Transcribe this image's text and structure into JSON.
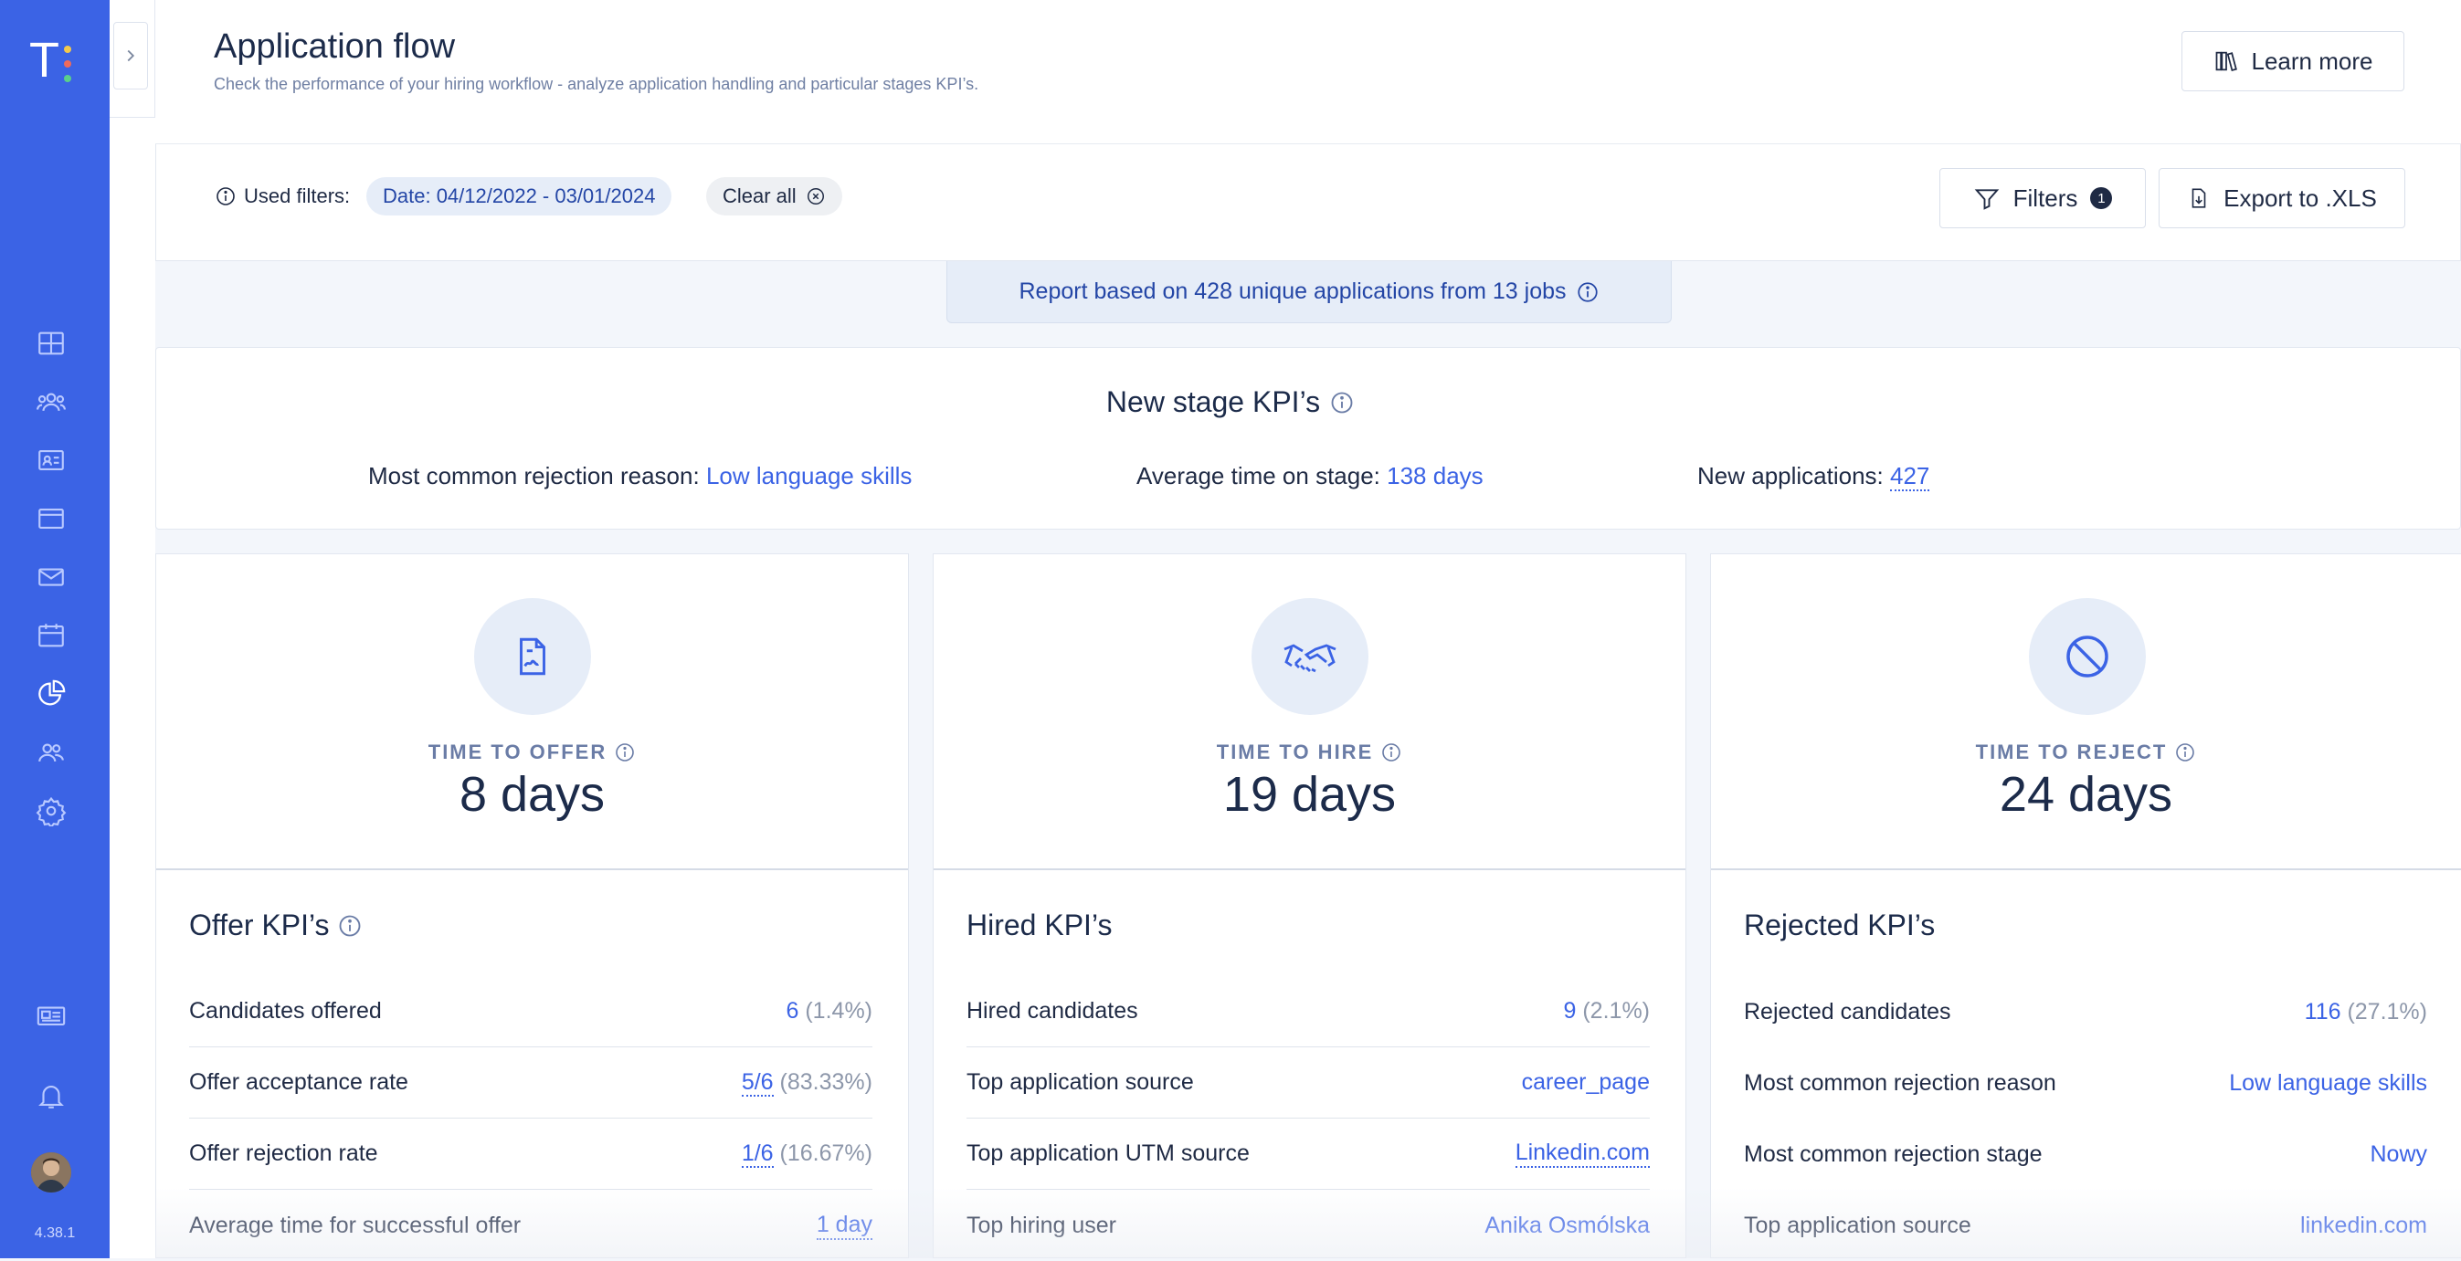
{
  "app": {
    "logo_letter": "T",
    "version": "4.38.1",
    "accent": "#3b63e5",
    "collapse_icon": "chevron-right-icon"
  },
  "sidebar_icons": [
    "dashboard-icon",
    "candidates-icon",
    "contact-card-icon",
    "jobs-window-icon",
    "mail-icon",
    "calendar-icon",
    "reports-pie-icon",
    "team-icon",
    "settings-gear-icon",
    "news-icon",
    "bell-icon"
  ],
  "header": {
    "title": "Application flow",
    "subtitle": "Check the performance of your hiring workflow - analyze application handling and particular stages KPI’s.",
    "learn_more": "Learn more"
  },
  "filters": {
    "used_label": "Used filters:",
    "date_chip": "Date: 04/12/2022 - 03/01/2024",
    "clear_all": "Clear all",
    "filters_button": "Filters",
    "filters_count": "1",
    "export_button": "Export to .XLS"
  },
  "report_banner": "Report based on 428 unique applications from 13 jobs",
  "new_stage": {
    "title": "New stage KPI’s",
    "rejection_label": "Most common rejection reason:",
    "rejection_value": "Low language skills",
    "avg_time_label": "Average time on stage:",
    "avg_time_value": "138 days",
    "new_apps_label": "New applications:",
    "new_apps_value": "427"
  },
  "columns": [
    {
      "kpi_label": "TIME TO OFFER",
      "kpi_value": "8 days",
      "icon": "offer-document-icon",
      "section_title": "Offer KPI’s",
      "rows": [
        {
          "label": "Candidates offered",
          "value": "6",
          "extra": "(1.4%)"
        },
        {
          "label": "Offer acceptance rate",
          "value": "5/6",
          "extra": "(83.33%)"
        },
        {
          "label": "Offer rejection rate",
          "value": "1/6",
          "extra": "(16.67%)"
        },
        {
          "label": "Average time for successful offer",
          "value": "1 day",
          "extra": ""
        }
      ]
    },
    {
      "kpi_label": "TIME TO HIRE",
      "kpi_value": "19 days",
      "icon": "handshake-icon",
      "section_title": "Hired KPI’s",
      "rows": [
        {
          "label": "Hired candidates",
          "value": "9",
          "extra": "(2.1%)"
        },
        {
          "label": "Top application source",
          "value": "career_page",
          "extra": ""
        },
        {
          "label": "Top application UTM source",
          "value": "Linkedin.com",
          "extra": ""
        },
        {
          "label": "Top hiring user",
          "value": "Anika Osmólska",
          "extra": ""
        }
      ]
    },
    {
      "kpi_label": "TIME TO REJECT",
      "kpi_value": "24 days",
      "icon": "prohibited-icon",
      "section_title": "Rejected KPI’s",
      "rows": [
        {
          "label": "Rejected candidates",
          "value": "116",
          "extra": "(27.1%)"
        },
        {
          "label": "Most common rejection reason",
          "value": "Low language skills",
          "extra": ""
        },
        {
          "label": "Most common rejection stage",
          "value": "Nowy",
          "extra": ""
        },
        {
          "label": "Top application source",
          "value": "linkedin.com",
          "extra": ""
        }
      ]
    }
  ]
}
